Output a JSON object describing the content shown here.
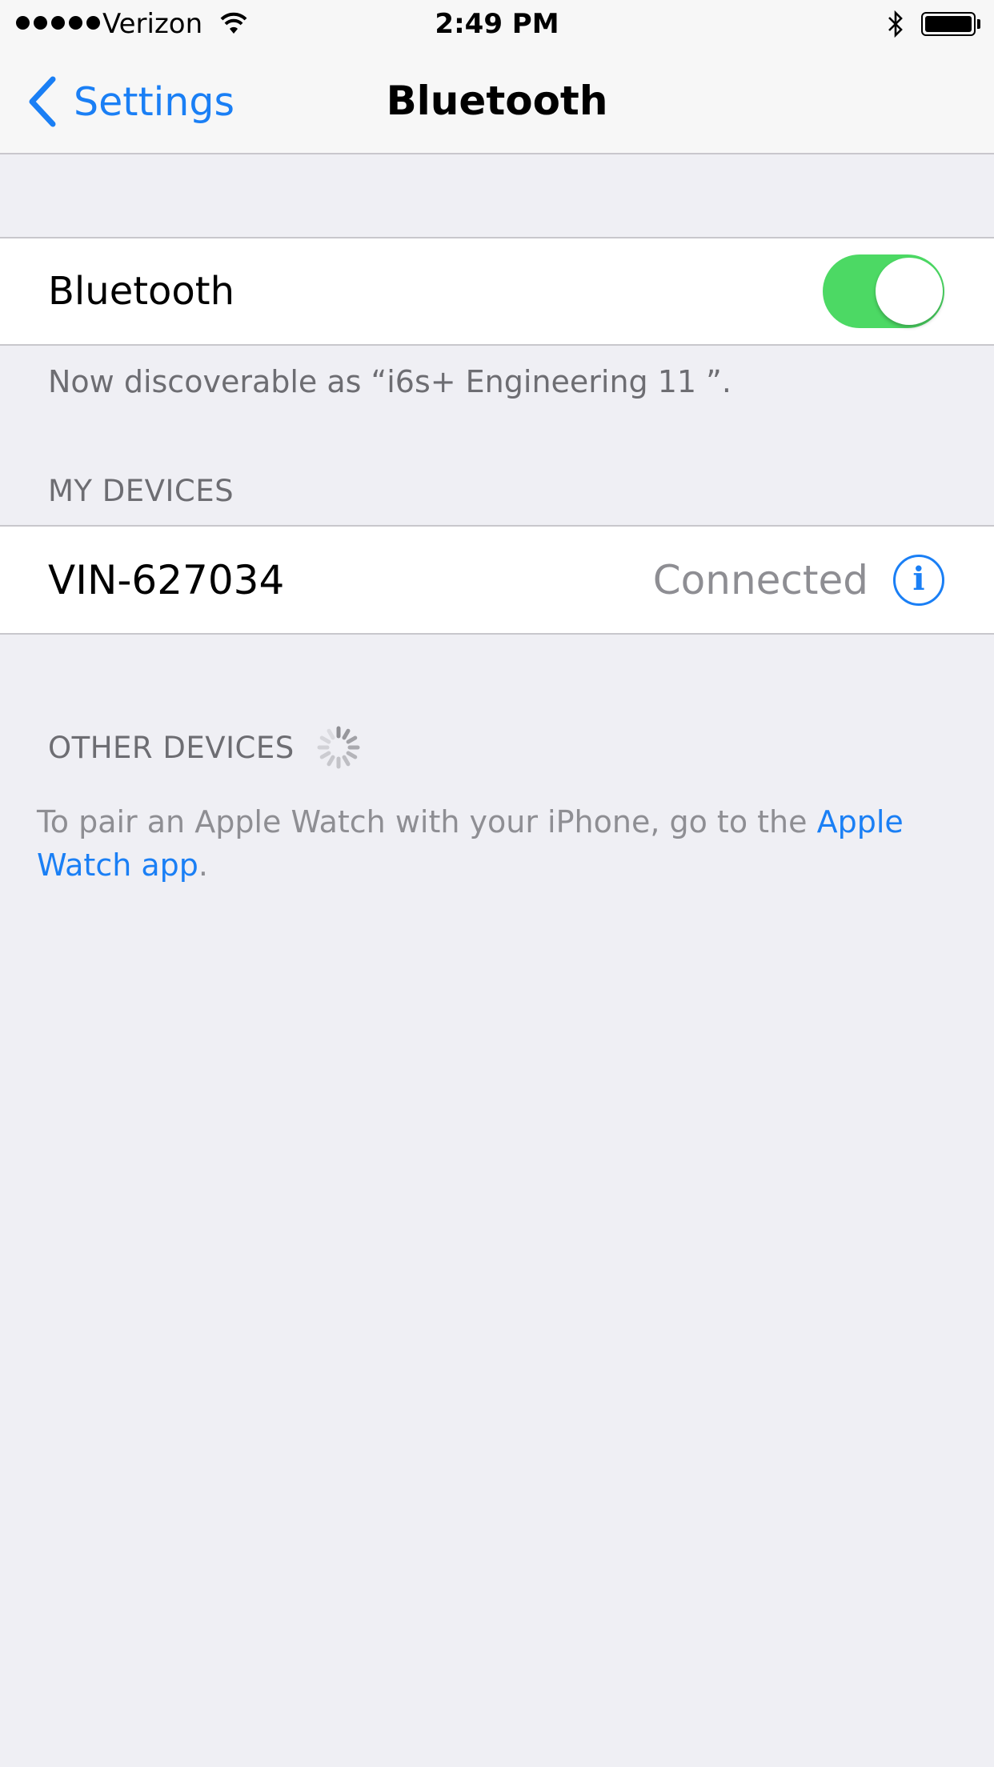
{
  "status_bar": {
    "carrier": "Verizon",
    "time": "2:49 PM",
    "signal_bars": 5,
    "battery_level": 1.0
  },
  "nav": {
    "back_label": "Settings",
    "title": "Bluetooth"
  },
  "bluetooth_cell": {
    "label": "Bluetooth",
    "toggle_on": true
  },
  "discoverable_text": "Now discoverable as “i6s+ Engineering 11 ”.",
  "my_devices": {
    "header": "MY DEVICES",
    "devices": [
      {
        "name": "VIN-627034",
        "status": "Connected",
        "info_glyph": "i"
      }
    ]
  },
  "other_devices": {
    "header": "OTHER DEVICES"
  },
  "pair_hint": {
    "prefix": "To pair an Apple Watch with your iPhone, go to the ",
    "link": "Apple Watch app",
    "suffix": "."
  },
  "colors": {
    "accent": "#1a7ff5",
    "toggle_on": "#4cd964",
    "background": "#efeff4",
    "secondary_text": "#6d6d72"
  },
  "icons": {
    "wifi": "wifi-icon",
    "bluetooth": "bluetooth-icon",
    "battery": "battery-icon",
    "back": "chevron-left-icon",
    "info": "info-icon",
    "spinner": "activity-spinner-icon"
  }
}
